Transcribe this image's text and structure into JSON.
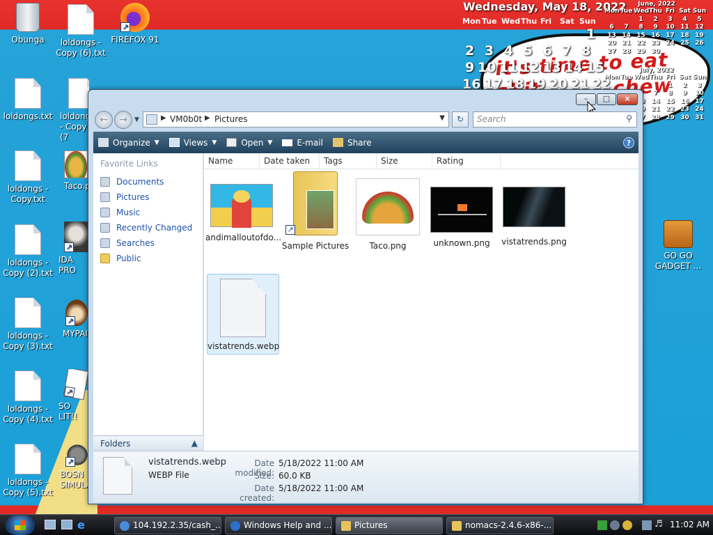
{
  "desktop": {
    "icons": [
      {
        "label": "Obunga"
      },
      {
        "label": "loldongs - Copy (6).txt"
      },
      {
        "label": "FIREFOX 91"
      },
      {
        "label": "loldongs.txt"
      },
      {
        "label": "loldongs - Copy (7"
      },
      {
        "label": "loldongs - Copy.txt"
      },
      {
        "label": "Taco.p"
      },
      {
        "label": "loldongs - Copy (2).txt"
      },
      {
        "label": "IDA PRO"
      },
      {
        "label": "loldongs - Copy (3).txt"
      },
      {
        "label": "MYPAI"
      },
      {
        "label": "loldongs - Copy (4).txt"
      },
      {
        "label": "SO LIT!!"
      },
      {
        "label": "loldongs - Copy (5).txt"
      },
      {
        "label": "BOSN SIMULA"
      },
      {
        "label": "GO GO GADGET ..."
      }
    ],
    "wallpaper_text_1": "it's time to eat shit",
    "wallpaper_text_2": "chew"
  },
  "calendar": {
    "date_line": "Wednesday, May 18, 2022",
    "weekdays": [
      "Mon",
      "Tue",
      "Wed",
      "Thu",
      "Fri",
      "Sat",
      "Sun"
    ],
    "big_numbers": [
      "1",
      "2",
      "3",
      "4",
      "5",
      "6",
      "7",
      "8",
      "9",
      "10",
      "11",
      "12",
      "13",
      "14",
      "15",
      "16",
      "17",
      "18",
      "19",
      "20",
      "21",
      "22"
    ],
    "june": {
      "title": "June, 2022",
      "weekdays": [
        "Mon",
        "Tue",
        "Wed",
        "Thu",
        "Fri",
        "Sat",
        "Sun"
      ],
      "days": [
        "",
        "",
        "1",
        "2",
        "3",
        "4",
        "5",
        "6",
        "7",
        "8",
        "9",
        "10",
        "11",
        "12",
        "13",
        "14",
        "15",
        "16",
        "17",
        "18",
        "19",
        "20",
        "21",
        "22",
        "23",
        "24",
        "25",
        "26",
        "27",
        "28",
        "29",
        "30",
        "",
        "",
        ""
      ]
    },
    "july": {
      "title": "July, 2022",
      "weekdays": [
        "Mon",
        "Tue",
        "Wed",
        "Thu",
        "Fri",
        "Sat",
        "Sun"
      ],
      "days": [
        "",
        "",
        "",
        "",
        "1",
        "2",
        "3",
        "4",
        "5",
        "6",
        "7",
        "8",
        "9",
        "10",
        "11",
        "12",
        "13",
        "14",
        "15",
        "16",
        "17",
        "18",
        "19",
        "20",
        "21",
        "22",
        "23",
        "24",
        "25",
        "26",
        "27",
        "28",
        "29",
        "30",
        "31"
      ]
    }
  },
  "explorer": {
    "breadcrumb": [
      "VM0b0t",
      "Pictures"
    ],
    "search_placeholder": "Search",
    "toolbar": {
      "organize": "Organize",
      "views": "Views",
      "open": "Open",
      "email": "E-mail",
      "share": "Share"
    },
    "favorite_links_header": "Favorite Links",
    "favorite_links": [
      "Documents",
      "Pictures",
      "Music",
      "Recently Changed",
      "Searches",
      "Public"
    ],
    "folders_label": "Folders",
    "columns": [
      "Name",
      "Date taken",
      "Tags",
      "Size",
      "Rating"
    ],
    "files": [
      {
        "name": "andimalloutofdo...",
        "thumb": "cartoon-image"
      },
      {
        "name": "Sample Pictures",
        "thumb": "folder-shortcut"
      },
      {
        "name": "Taco.png",
        "thumb": "taco-image"
      },
      {
        "name": "unknown.png",
        "thumb": "dark-screenshot"
      },
      {
        "name": "vistatrends.png",
        "thumb": "vista-wallpaper"
      },
      {
        "name": "vistatrends.webp",
        "thumb": "generic-file"
      }
    ],
    "details": {
      "filename": "vistatrends.webp",
      "filetype": "WEBP File",
      "labels": {
        "modified": "Date modified:",
        "size": "Size:",
        "created": "Date created:"
      },
      "modified": "5/18/2022 11:00 AM",
      "size": "60.0 KB",
      "created": "5/18/2022 11:00 AM"
    }
  },
  "taskbar": {
    "tasks": [
      {
        "label": "104.192.2.35/cash_..."
      },
      {
        "label": "Windows Help and ..."
      },
      {
        "label": "Pictures"
      },
      {
        "label": "nomacs-2.4.6-x86-..."
      }
    ],
    "clock": "11:02 AM"
  }
}
